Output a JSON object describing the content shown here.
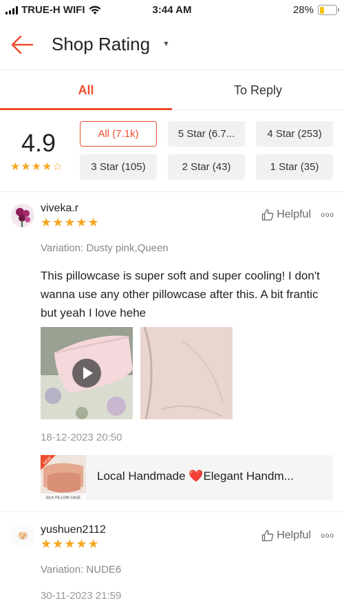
{
  "status": {
    "carrier": "TRUE-H WIFI",
    "time": "3:44 AM",
    "battery": "28%",
    "battery_level": 0.28
  },
  "header": {
    "title": "Shop Rating"
  },
  "tabs": [
    {
      "label": "All"
    },
    {
      "label": "To Reply"
    }
  ],
  "summary": {
    "score": "4.9",
    "stars": "★★★★☆",
    "filters": [
      {
        "label": "All (7.1k)"
      },
      {
        "label": "5 Star (6.7..."
      },
      {
        "label": "4 Star (253)"
      },
      {
        "label": "3 Star (105)"
      },
      {
        "label": "2 Star (43)"
      },
      {
        "label": "1 Star (35)"
      }
    ]
  },
  "reviews": [
    {
      "username": "viveka.r",
      "stars": "★★★★★",
      "helpful_label": "Helpful",
      "more": "ooo",
      "variation": "Variation: Dusty pink,Queen",
      "comment": "This pillowcase is super soft and super cooling! I don't wanna use any other pillowcase after this. A bit frantic but yeah I love hehe",
      "date": "18-12-2023 20:50",
      "product": {
        "name_before": "Local Handmade ",
        "heart": "❤️",
        "name_after": "Elegant Handm...",
        "thumb_badge": "NEW",
        "thumb_caption": "SILK PILLOW CASE"
      }
    },
    {
      "username": "yushuen2112",
      "stars": "★★★★★",
      "helpful_label": "Helpful",
      "more": "ooo",
      "variation": "Variation: NUDE6",
      "date": "30-11-2023 21:59"
    }
  ],
  "colors": {
    "accent": "#ee4d2d",
    "star": "#f5a623"
  }
}
